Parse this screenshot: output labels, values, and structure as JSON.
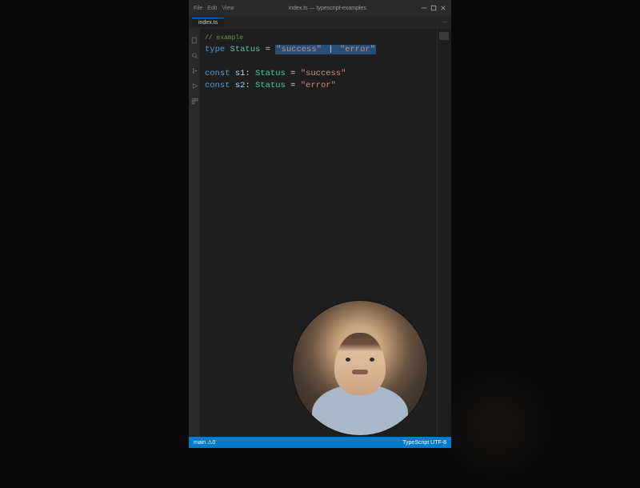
{
  "titlebar": {
    "menu": [
      "File",
      "Edit",
      "View"
    ],
    "center": "index.ts — typescript-examples",
    "window_controls": [
      "minimize",
      "maximize",
      "close"
    ]
  },
  "tabs": {
    "active": "index.ts",
    "icon": "ts-icon"
  },
  "activity": [
    "files-icon",
    "search-icon",
    "git-icon",
    "debug-icon",
    "ext-icon"
  ],
  "code": {
    "comment": "// example",
    "l1_kw": "type ",
    "l1_name": "Status",
    "l1_eq": " = ",
    "l1_s1": "\"success\"",
    "l1_pipe": " | ",
    "l1_s2": "\"error\"",
    "l3_kw": "const ",
    "l3_var": "s1",
    "l3_colon": ": ",
    "l3_type": "Status",
    "l3_eq": " = ",
    "l3_val": "\"success\"",
    "l4_kw": "const ",
    "l4_var": "s2",
    "l4_colon": ": ",
    "l4_type": "Status",
    "l4_eq": " = ",
    "l4_val": "\"error\""
  },
  "status": {
    "left": "main  ⚠0",
    "right": "TypeScript  UTF-8"
  },
  "webcam": {
    "label": "presenter-camera"
  }
}
